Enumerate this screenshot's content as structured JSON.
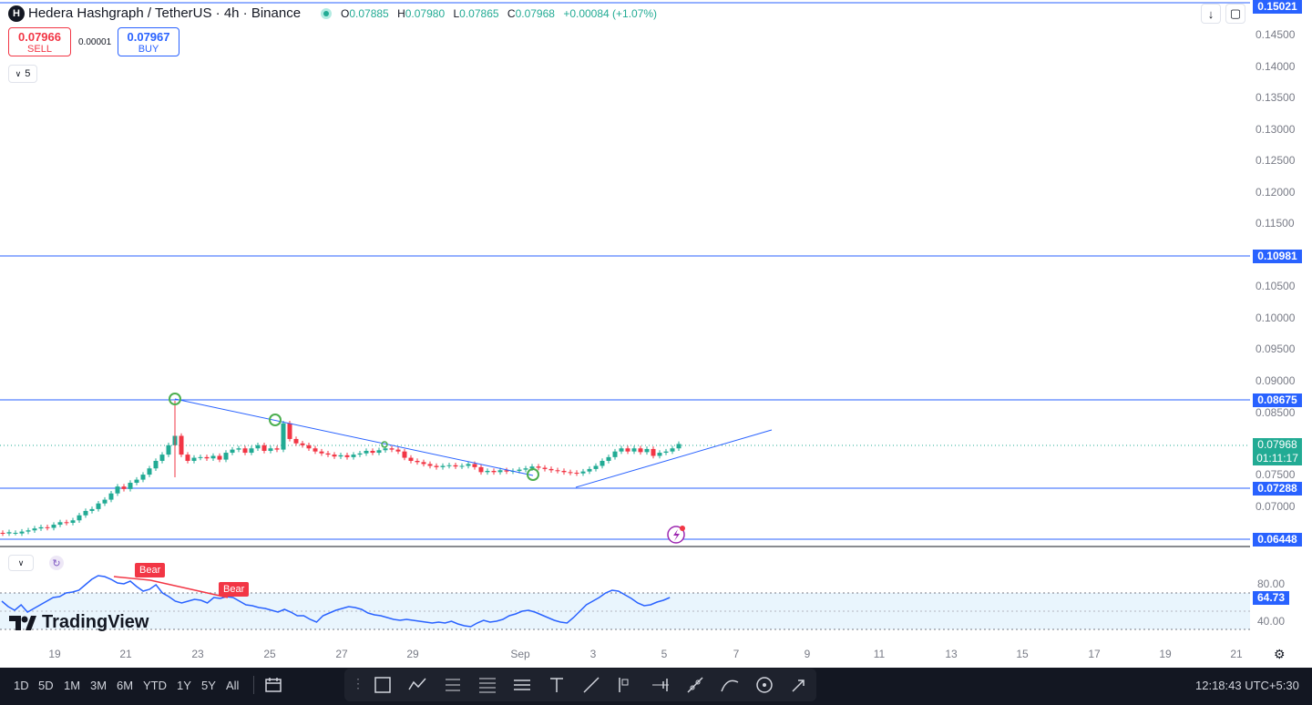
{
  "header": {
    "symbol_badge": "H",
    "title": "Hedera Hashgraph / TetherUS · 4h · Binance",
    "ohlc": {
      "o_label": "O",
      "o": "0.07885",
      "h_label": "H",
      "h": "0.07980",
      "l_label": "L",
      "l": "0.07865",
      "c_label": "C",
      "c": "0.07968",
      "change": "+0.00084 (+1.07%)"
    }
  },
  "trade": {
    "sell_price": "0.07966",
    "sell_label": "SELL",
    "spread": "0.00001",
    "buy_price": "0.07967",
    "buy_label": "BUY"
  },
  "bars_toggle": "5",
  "price_axis": {
    "ticks": [
      "0.14500",
      "0.14000",
      "0.13500",
      "0.13000",
      "0.12500",
      "0.12000",
      "0.11500",
      "0.10500",
      "0.10000",
      "0.09500",
      "0.09000",
      "0.08500",
      "0.07500",
      "0.07000"
    ],
    "levels": [
      "0.15021",
      "0.10981",
      "0.08675",
      "0.07288",
      "0.06448"
    ],
    "current_price": "0.07968",
    "countdown": "01:11:17"
  },
  "time_axis": [
    "19",
    "21",
    "23",
    "25",
    "27",
    "29",
    "Sep",
    "3",
    "5",
    "7",
    "9",
    "11",
    "13",
    "15",
    "17",
    "19",
    "21"
  ],
  "rsi": {
    "value": "64.73",
    "ticks": [
      "80.00",
      "40.00"
    ],
    "labels": [
      "Bear",
      "Bear"
    ]
  },
  "brand": "TradingView",
  "ranges": [
    "1D",
    "5D",
    "1M",
    "3M",
    "6M",
    "YTD",
    "1Y",
    "5Y",
    "All"
  ],
  "tools": [
    "selection-tool",
    "trend-tool",
    "long-position-tool",
    "fib-tool",
    "pattern-tool",
    "text-tool",
    "line-tool",
    "forecast-tool",
    "bars-pattern-tool",
    "brush-tool",
    "curve-tool",
    "circle-tool",
    "arrow-tool"
  ],
  "clock": "12:18:43 UTC+5:30",
  "colors": {
    "up": "#22ab94",
    "down": "#f23645",
    "accent": "#2962ff",
    "bg_dark": "#131722"
  },
  "chart_data": {
    "type": "candlestick",
    "instrument": "HBARUSDT",
    "interval": "4h",
    "ylim": [
      0.064,
      0.1505
    ],
    "levels": [
      0.15021,
      0.10981,
      0.08675,
      0.07288,
      0.06448
    ],
    "last": 0.07968,
    "rsi_last": 64.73
  }
}
